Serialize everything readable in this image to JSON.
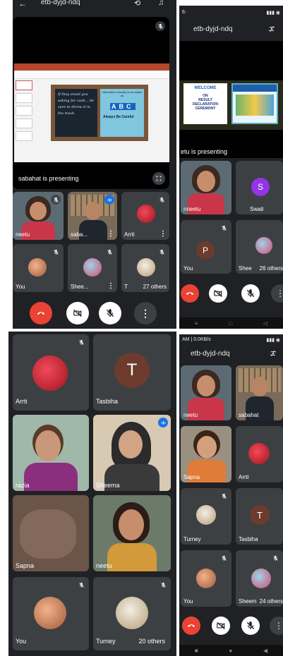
{
  "p1": {
    "title": "etb-dyjd-ndq",
    "presenting": "sabahat is presenting",
    "slide_left_text": "If they email you asking for cash... be sure to throw it in the trash.",
    "slide_right_title": "Information security is as simple as",
    "slide_acronym": "ABC",
    "slide_acronym_words": "Always Be Careful",
    "tiles": [
      "neetu",
      "saba...",
      "Arrti",
      "You",
      "Shee...",
      "T"
    ],
    "others": "27 others"
  },
  "p2": {
    "status": "6:",
    "title": "etb-dyjd-ndq",
    "slide_welcome": "WELCOME",
    "slide_on": "ON",
    "slide_result": "RESULT",
    "slide_declaration": "DECLARATION",
    "slide_ceremony": "CEREMONY",
    "presenting": "etu is presenting",
    "tiles": [
      "nneetu",
      "Swati",
      "You",
      "Shee"
    ],
    "swati_initial": "S",
    "you_initial": "P",
    "others": "26 others"
  },
  "p3": {
    "tiles": [
      "Arrti",
      "Tasbiha",
      "razia",
      "Sheema",
      "Sapna",
      "neetu",
      "You",
      "Turney"
    ],
    "tasbiha_initial": "T",
    "others": "20 others"
  },
  "p4": {
    "status": "AM | 0.0KB/s",
    "title": "etb-dyjd-ndq",
    "tiles": [
      "neetu",
      "sabahat",
      "Sapna",
      "Arrti",
      "Turney",
      "Tasbiha",
      "You",
      "Sheem"
    ],
    "tasbiha_initial": "T",
    "others": "24 others"
  },
  "colors": {
    "bg": "#202124",
    "tile": "#3c4043",
    "end_call": "#ea4335",
    "accent_blue": "#1a73e8",
    "swati_avatar": "#9334e6",
    "brown_avatar": "#6d3b2e"
  }
}
